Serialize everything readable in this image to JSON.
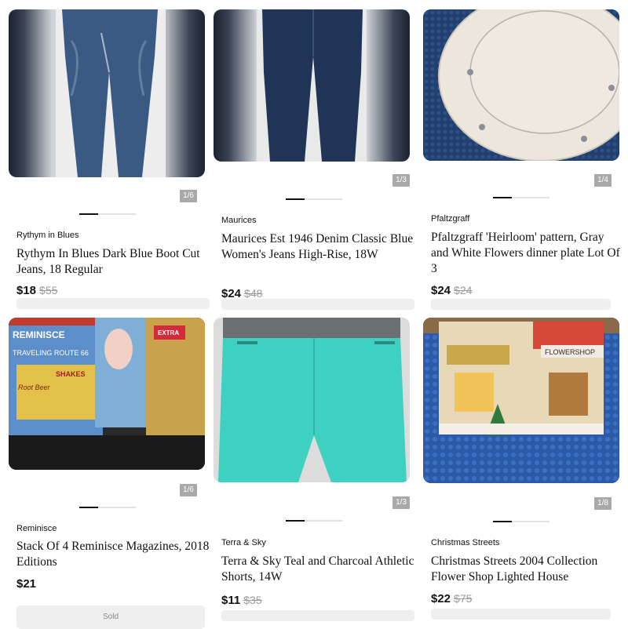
{
  "listings": [
    {
      "counter": "1/6",
      "brand": "Rythym in Blues",
      "title": "Rythym In Blues Dark Blue Boot Cut Jeans, 18 Regular",
      "price": "$18",
      "old_price": "$55"
    },
    {
      "counter": "1/3",
      "brand": "Maurices",
      "title": "Maurices Est 1946 Denim Classic Blue Women's Jeans High-Rise, 18W",
      "price": "$24",
      "old_price": "$48"
    },
    {
      "counter": "1/4",
      "brand": "Pfaltzgraff",
      "title": "Pfaltzgraff 'Heirloom' pattern, Gray and White Flowers dinner plate Lot Of 3",
      "price": "$24",
      "old_price": "$24"
    },
    {
      "counter": "1/6",
      "brand": "Reminisce",
      "title": "Stack Of 4 Reminisce Magazines, 2018 Editions",
      "price": "$21",
      "old_price": ""
    },
    {
      "counter": "1/3",
      "brand": "Terra & Sky",
      "title": "Terra & Sky Teal and Charcoal Athletic Shorts, 14W",
      "price": "$11",
      "old_price": "$35"
    },
    {
      "counter": "1/8",
      "brand": "Christmas Streets",
      "title": "Christmas Streets 2004 Collection Flower Shop Lighted House",
      "price": "$22",
      "old_price": "$75"
    }
  ],
  "image_texts": {
    "magazine_headline": "REMINISCE",
    "magazine_route": "TRAVELING ROUTE 66",
    "magazine_shakes": "SHAKES",
    "magazine_rootbeer": "Root Beer",
    "magazine_extra": "EXTRA",
    "flowershop_sign": "FLOWERSHOP"
  },
  "partial_button_label": "Sold"
}
